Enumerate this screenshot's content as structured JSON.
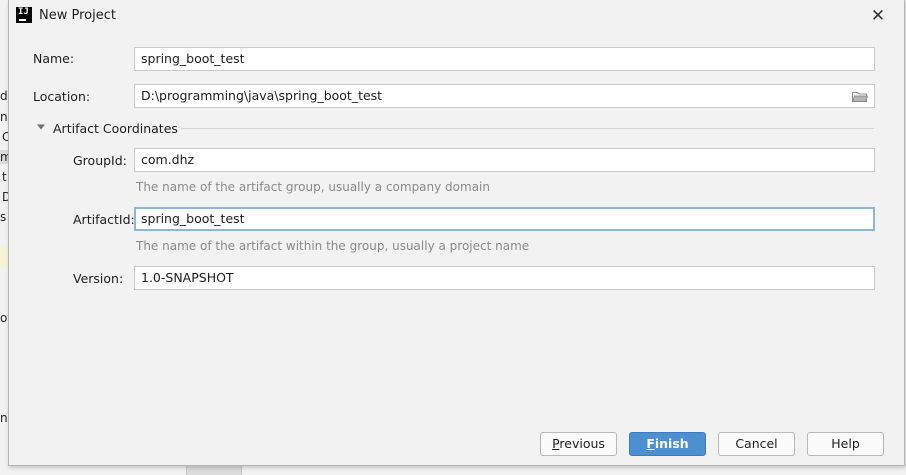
{
  "window": {
    "title": "New Project"
  },
  "form": {
    "name_label": "Name:",
    "name_value": "spring_boot_test",
    "location_label": "Location:",
    "location_value": "D:\\programming\\java\\spring_boot_test",
    "section_title": "Artifact Coordinates",
    "groupid_label": "GroupId:",
    "groupid_value": "com.dhz",
    "groupid_hint": "The name of the artifact group, usually a company domain",
    "artifactid_label": "ArtifactId:",
    "artifactid_value": "spring_boot_test",
    "artifactid_hint": "The name of the artifact within the group, usually a project name",
    "version_label": "Version:",
    "version_value": "1.0-SNAPSHOT"
  },
  "buttons": {
    "previous_mnemonic": "P",
    "previous_rest": "revious",
    "finish_mnemonic": "F",
    "finish_rest": "inish",
    "cancel": "Cancel",
    "help": "Help"
  },
  "background": {
    "fragments": [
      "dh",
      "nt",
      "C",
      "m",
      "t",
      "D",
      "s",
      "ot",
      "ns"
    ]
  },
  "colors": {
    "primary_button": "#4d8fd1",
    "focus_border": "#8eb6dc",
    "hint_text": "#8a8a8a"
  }
}
